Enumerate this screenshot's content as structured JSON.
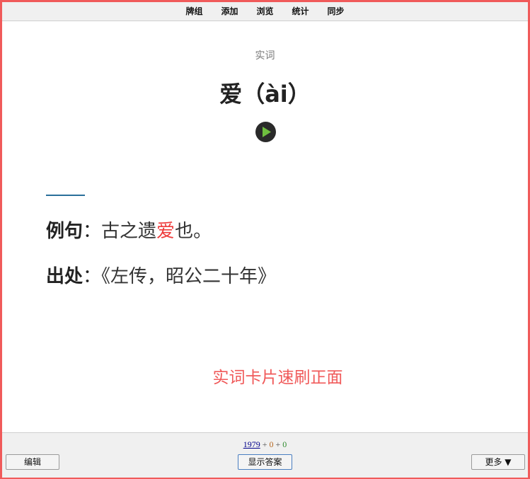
{
  "topbar": {
    "items": [
      {
        "label": "牌组"
      },
      {
        "label": "添加"
      },
      {
        "label": "浏览"
      },
      {
        "label": "统计"
      },
      {
        "label": "同步"
      }
    ]
  },
  "card": {
    "type_label": "实词",
    "word": "爱（ài）",
    "audio_icon": "play-icon",
    "example": {
      "label": "例句",
      "colon": "：",
      "before": "古之遗",
      "highlight": "爱",
      "after": "也。"
    },
    "source": {
      "label": "出处",
      "colon": "：",
      "text": "《左传，昭公二十年》"
    },
    "note": "实词卡片速刷正面"
  },
  "bottombar": {
    "counts": {
      "new": "1979",
      "sep1": " + ",
      "learn": "0",
      "sep2": " + ",
      "review": "0"
    },
    "edit_label": "编辑",
    "show_answer_label": "显示答案",
    "more_label": "更多 ▼"
  },
  "colors": {
    "frame": "#f05a5a",
    "highlight": "#ee3b3b",
    "divider": "#2a6f9a",
    "play_triangle": "#6fbf3f"
  }
}
